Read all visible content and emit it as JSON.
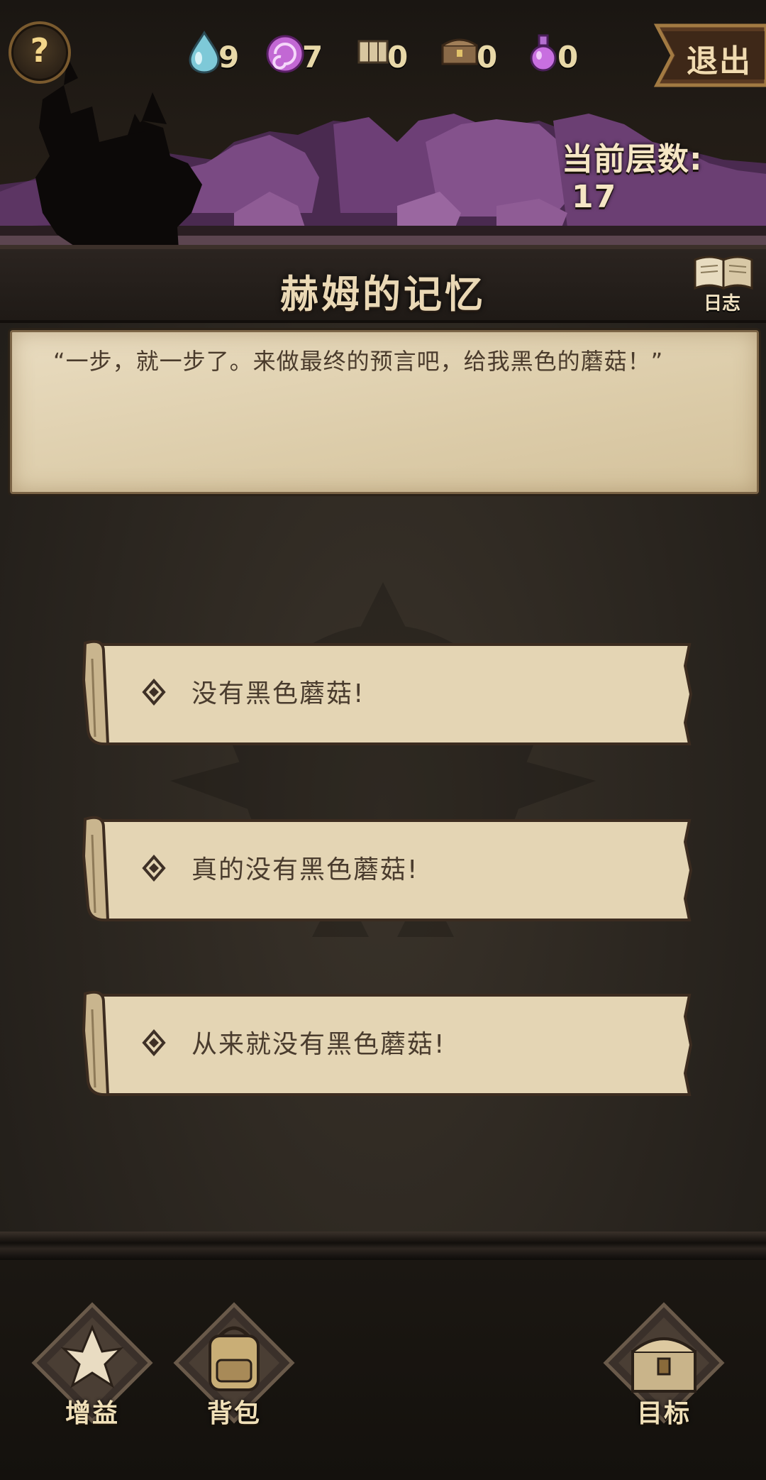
{
  "header": {
    "help_label": "?",
    "resources": [
      {
        "icon": "water-drop-icon",
        "value": "9"
      },
      {
        "icon": "purple-swirl-icon",
        "value": "7"
      },
      {
        "icon": "scroll-map-icon",
        "value": "0"
      },
      {
        "icon": "treasure-chest-icon",
        "value": "0"
      },
      {
        "icon": "potion-flask-icon",
        "value": "0"
      }
    ],
    "exit_label": "退出",
    "floor_label": "当前层数:",
    "floor_value": "17",
    "title": "赫姆的记忆",
    "log_label": "日志"
  },
  "dialog": {
    "text": "“一步，就一步了。来做最终的预言吧，给我黑色的蘑菇！”"
  },
  "choices": [
    {
      "label": "没有黑色蘑菇!"
    },
    {
      "label": "真的没有黑色蘑菇!"
    },
    {
      "label": "从来就没有黑色蘑菇!"
    }
  ],
  "bottom_nav": {
    "buff_label": "增益",
    "bag_label": "背包",
    "goal_label": "目标"
  },
  "colors": {
    "parchment": "#e2d4b5",
    "accent_gold": "#f3d68a",
    "rock_purple": "#6b3f73"
  }
}
